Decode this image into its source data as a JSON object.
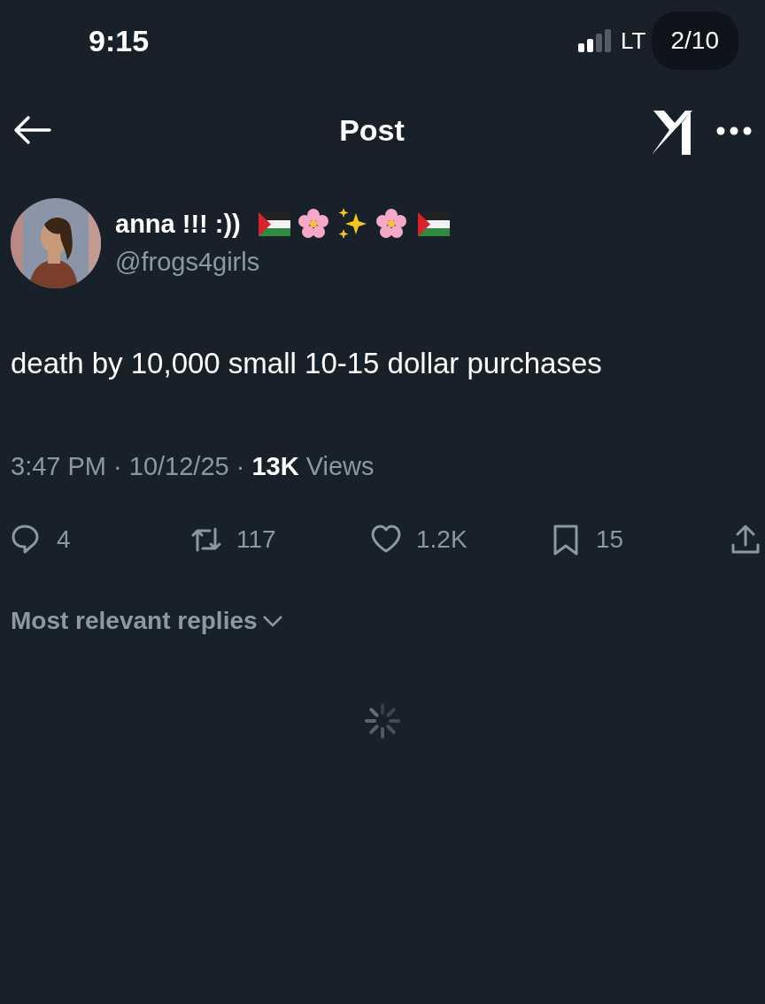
{
  "status_bar": {
    "time": "9:15",
    "network": "LT",
    "page_counter": "2/10"
  },
  "header": {
    "title": "Post"
  },
  "author": {
    "name": "anna !!! :))",
    "handle": "@frogs4girls"
  },
  "post": {
    "text": "death by 10,000 small 10-15 dollar purchases",
    "meta": "3:47 PM · 10/12/25 · **13K** Views"
  },
  "actions": [
    {
      "kind": "reply",
      "count": "4"
    },
    {
      "kind": "repost",
      "count": "117"
    },
    {
      "kind": "like",
      "count": "1.2K"
    },
    {
      "kind": "bookmark",
      "count": "15"
    },
    {
      "kind": "share"
    }
  ],
  "replies": {
    "sort_label": "Most relevant replies",
    "loading": true
  }
}
